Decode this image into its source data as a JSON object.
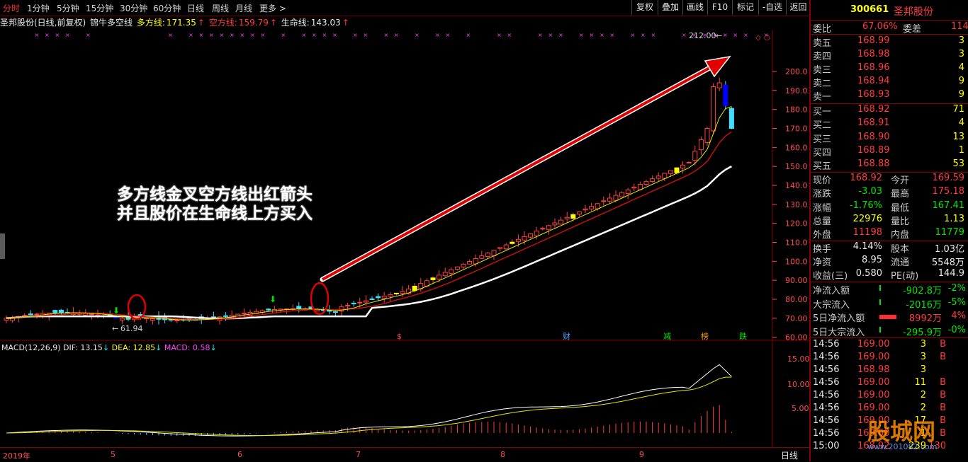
{
  "toolbar": {
    "periods": [
      "分时",
      "1分钟",
      "5分钟",
      "15分钟",
      "30分钟",
      "60分钟",
      "日线",
      "周线",
      "月线",
      "更多 >"
    ],
    "buttons": [
      "复权",
      "叠加",
      "画线",
      "F10",
      "标记",
      "-自选",
      "返回"
    ]
  },
  "info": {
    "name_period": "圣邦股份(日线,前复权)",
    "indicator": "锦牛多空线",
    "long_label": "多方线:",
    "long_value": "171.35",
    "short_label": "空方线:",
    "short_value": "159.79",
    "life_label": "生命线:",
    "life_value": "143.03"
  },
  "annotation": {
    "line1": "多方线金叉空方线出红箭头",
    "line2": "并且股价在生命线上方买入"
  },
  "price_axis": [
    "200.0",
    "190.0",
    "180.0",
    "170.0",
    "160.0",
    "150.0",
    "140.0",
    "130.0",
    "120.0",
    "110.0",
    "100.0",
    "90.00",
    "80.00",
    "70.00",
    "60.00"
  ],
  "markers": {
    "high": "212.00",
    "low": "61.94"
  },
  "event_labels": [
    "$",
    "财",
    "减",
    "榜",
    "跌"
  ],
  "macd": {
    "label": "MACD(12,26,9)",
    "dif_label": "DIF: 13.15",
    "dea_label": "DEA: 12.85",
    "macd_label": "MACD: 0.58",
    "axis": [
      "15.00",
      "10.00",
      "5.00"
    ]
  },
  "time_axis": {
    "year": "2019年",
    "months": [
      "5",
      "6",
      "7",
      "8",
      "9"
    ],
    "period": "日线"
  },
  "panel": {
    "code": "300661",
    "name": "圣邦股份",
    "webi_label": "委比",
    "webi_value": "67.06%",
    "weicha_label": "委差",
    "weicha_value": "114",
    "asks": [
      {
        "label": "卖五",
        "price": "168.99",
        "vol": "3"
      },
      {
        "label": "卖四",
        "price": "168.98",
        "vol": "3"
      },
      {
        "label": "卖三",
        "price": "168.96",
        "vol": "4"
      },
      {
        "label": "卖二",
        "price": "168.94",
        "vol": "9"
      },
      {
        "label": "卖一",
        "price": "168.93",
        "vol": "9"
      }
    ],
    "bids": [
      {
        "label": "买一",
        "price": "168.92",
        "vol": "71"
      },
      {
        "label": "买二",
        "price": "168.91",
        "vol": "4"
      },
      {
        "label": "买三",
        "price": "168.90",
        "vol": "13"
      },
      {
        "label": "买四",
        "price": "168.89",
        "vol": "1"
      },
      {
        "label": "买五",
        "price": "168.88",
        "vol": "53"
      }
    ],
    "quote": [
      {
        "l1": "现价",
        "v1": "168.92",
        "l2": "今开",
        "v2": "169.59"
      },
      {
        "l1": "涨跌",
        "v1": "-3.03",
        "l2": "最高",
        "v2": "175.18"
      },
      {
        "l1": "涨幅",
        "v1": "-1.76%",
        "l2": "最低",
        "v2": "167.41"
      },
      {
        "l1": "总量",
        "v1": "22976",
        "l2": "量比",
        "v2": "1.13"
      },
      {
        "l1": "外盘",
        "v1": "11198",
        "l2": "内盘",
        "v2": "11779"
      }
    ],
    "stats": [
      {
        "l1": "换手",
        "v1": "4.14%",
        "l2": "股本",
        "v2": "1.03亿"
      },
      {
        "l1": "净资",
        "v1": "8.95",
        "l2": "流通",
        "v2": "5548万"
      },
      {
        "l1": "收益(三)",
        "v1": "0.580",
        "l2": "PE(动)",
        "v2": "144.9"
      }
    ],
    "flows": [
      {
        "label": "净流入额",
        "value": "-902.8万",
        "pct": "-2%"
      },
      {
        "label": "大宗流入",
        "value": "-2016万",
        "pct": "-5%"
      },
      {
        "label": "5日净流入额",
        "value": "8992万",
        "pct": "4%"
      },
      {
        "label": "5日大宗流入",
        "value": "-295.9万",
        "pct": "-0%"
      }
    ],
    "ticks": [
      {
        "time": "14:56",
        "price": "169.00",
        "vol": "3",
        "side": "B"
      },
      {
        "time": "14:56",
        "price": "169.00",
        "vol": "3",
        "side": "B"
      },
      {
        "time": "14:56",
        "price": "168.98",
        "vol": "3",
        "side": ""
      },
      {
        "time": "14:56",
        "price": "169.00",
        "vol": "11",
        "side": "B"
      },
      {
        "time": "14:56",
        "price": "169.00",
        "vol": "2",
        "side": "B"
      },
      {
        "time": "14:56",
        "price": "169.00",
        "vol": "2",
        "side": "B"
      },
      {
        "time": "14:56",
        "price": "169.00",
        "vol": "17",
        "side": "B"
      },
      {
        "time": "14:56",
        "price": "169.00",
        "vol": "1",
        "side": "B"
      },
      {
        "time": "15:00",
        "price": "168.92",
        "vol": "239",
        "side": "130"
      }
    ],
    "watermark": "股城网",
    "watermark_url": "www.201082.com"
  },
  "chart_data": {
    "type": "candlestick",
    "title": "圣邦股份(日线,前复权)",
    "ylim": [
      58,
      222
    ],
    "series": [
      {
        "name": "多方线",
        "last": 171.35
      },
      {
        "name": "空方线",
        "last": 159.79
      },
      {
        "name": "生命线",
        "last": 143.03
      }
    ],
    "marked_high": 212.0,
    "marked_low": 61.94,
    "x_months": [
      "2019年",
      "5",
      "6",
      "7",
      "8",
      "9"
    ]
  }
}
